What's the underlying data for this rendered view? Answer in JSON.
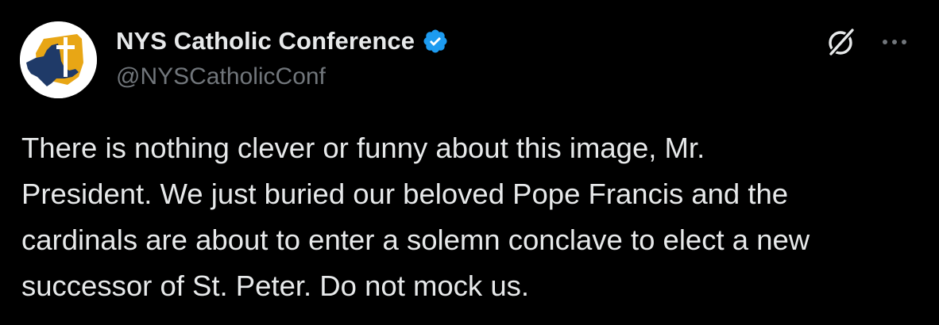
{
  "tweet": {
    "author": {
      "display_name": "NYS Catholic Conference",
      "handle": "@NYSCatholicConf",
      "verified": true,
      "verified_color": "#1d9bf0",
      "avatar_icon": "nys-map-cross-logo-icon"
    },
    "actions": {
      "grok_icon": "grok-icon",
      "more_icon": "more-options-icon"
    },
    "text_lines": [
      "There is nothing clever or funny about this image, Mr.",
      "President. We just buried our beloved Pope Francis and the",
      "cardinals are about to enter a solemn conclave to elect a new",
      "successor of St. Peter. Do not mock us."
    ]
  },
  "colors": {
    "background": "#000000",
    "primary_text": "#e7e9ea",
    "secondary_text": "#71767b",
    "accent": "#1d9bf0",
    "logo_gold": "#e8a615",
    "logo_navy": "#1f3a68"
  }
}
